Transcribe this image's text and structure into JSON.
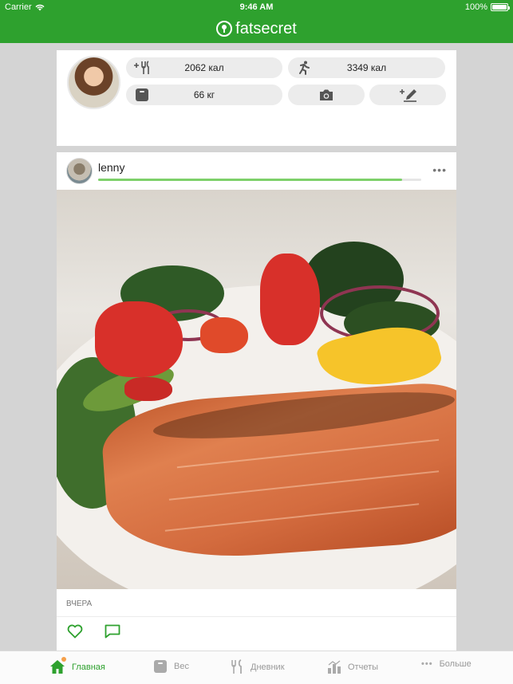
{
  "status_bar": {
    "carrier": "Carrier",
    "time": "9:46 AM",
    "battery": "100%",
    "battery_level": 1.0
  },
  "app": {
    "brand": "fatsecret",
    "accent_color": "#2ea12e",
    "notification_color": "#f5a04a"
  },
  "summary": {
    "food_calories": "2062 кал",
    "exercise_calories": "3349 кал",
    "weight": "66 кг",
    "icons": {
      "food": "add-food-icon",
      "exercise": "running-icon",
      "weight": "scale-icon",
      "camera": "camera-icon",
      "edit": "edit-entry-icon"
    },
    "notifications": [
      "bell-icon",
      "person-icon",
      "heart-icon",
      "chat-icon"
    ]
  },
  "post": {
    "username": "lenny",
    "progress": 0.94,
    "date": "ВЧЕРА",
    "photo_subject": "food-photo"
  },
  "tabs": [
    {
      "label": "Главная",
      "icon": "home-icon",
      "active": true
    },
    {
      "label": "Вес",
      "icon": "scale-icon",
      "active": false
    },
    {
      "label": "Дневник",
      "icon": "utensils-icon",
      "active": false
    },
    {
      "label": "Отчеты",
      "icon": "reports-icon",
      "active": false
    },
    {
      "label": "Больше",
      "icon": "more-dots-icon",
      "active": false
    }
  ]
}
